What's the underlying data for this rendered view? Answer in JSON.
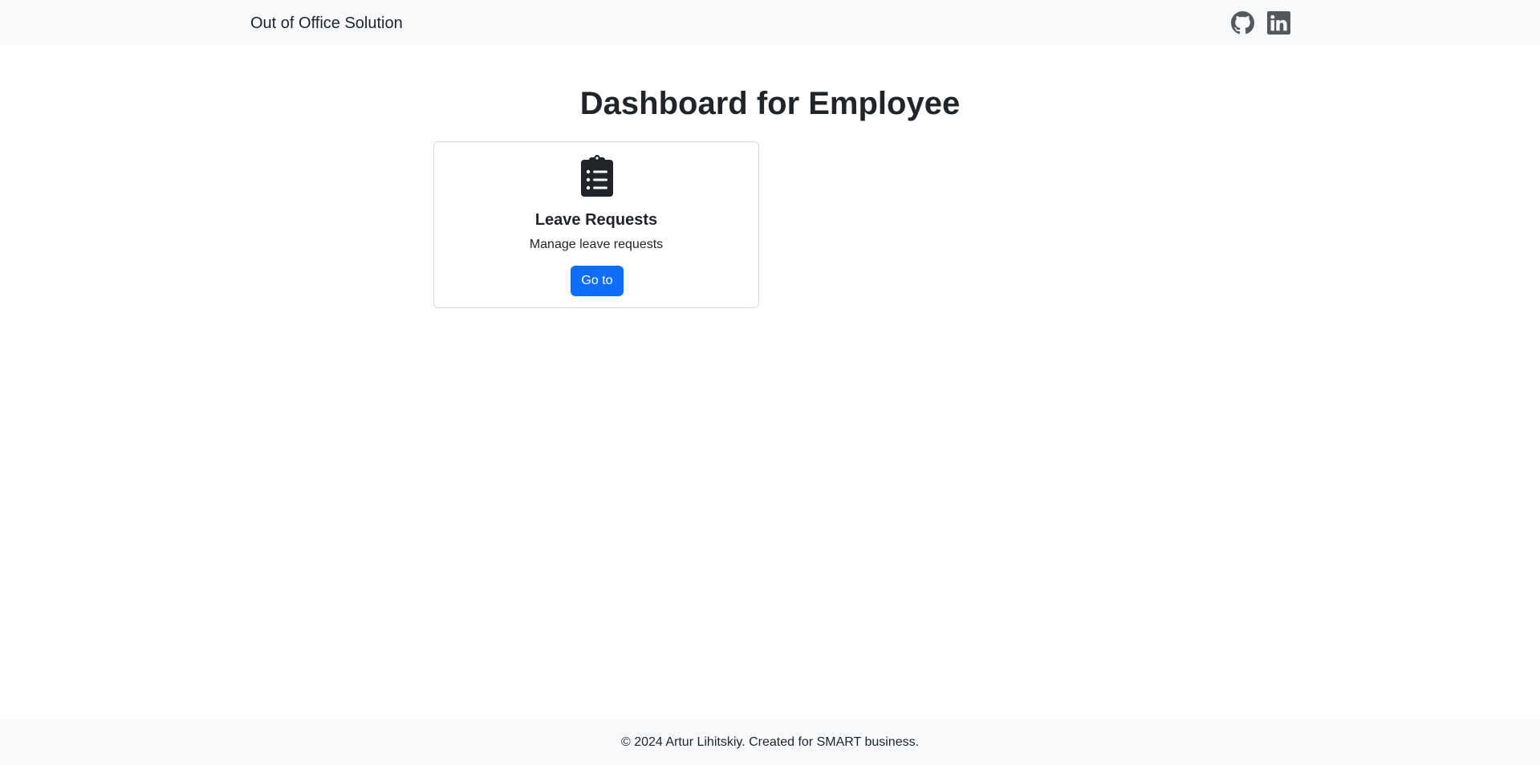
{
  "navbar": {
    "brand": "Out of Office Solution",
    "icons": [
      "github-icon",
      "linkedin-icon"
    ],
    "icon_color": "#53585d",
    "background": "#f8f9fa"
  },
  "main": {
    "title": "Dashboard for Employee",
    "cards": [
      {
        "icon": "clipboard-list-icon",
        "title": "Leave Requests",
        "text": "Manage leave requests",
        "button_label": "Go to"
      }
    ]
  },
  "footer": {
    "text": "© 2024 Artur Lihitskiy. Created for SMART business."
  },
  "colors": {
    "primary": "#0d6efd",
    "text": "#212529"
  }
}
